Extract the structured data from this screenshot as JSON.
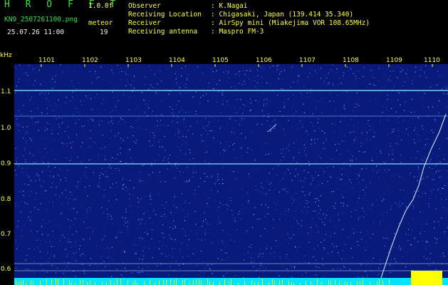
{
  "header": {
    "app_name": "H R O F F T",
    "fft_label": "1.0.0f",
    "filename": "KN9_2507261100.png",
    "meteor_label": "meteor",
    "datetime": "25.07.26 11:00",
    "meteor_count": "19",
    "info": [
      {
        "label": "Observer",
        "value": ": K.Nagai"
      },
      {
        "label": "Receiving Location",
        "value": ": Chigasaki, Japan (139.414 35.340)"
      },
      {
        "label": "Receiver",
        "value": ": AirSpy mini (Miakejima VOR 108.65MHz)"
      },
      {
        "label": "Receiving antenna",
        "value": ": Maspro FM-3"
      }
    ]
  },
  "x_axis": {
    "ticks": [
      "1101",
      "1102",
      "1103",
      "1104",
      "1105",
      "1106",
      "1107",
      "1108",
      "1109",
      "1110"
    ]
  },
  "y_axis": {
    "unit": "kHz",
    "ticks": [
      "1.1",
      "1.0",
      "0.9",
      "0.8",
      "0.7",
      "0.6"
    ]
  },
  "colors": {
    "background": "#000000",
    "spectrogram_bg": "#0a1a7a",
    "signal_line": "#66ddff",
    "baseline": "#00e5ff",
    "meteor_bars": "#ffff00"
  }
}
